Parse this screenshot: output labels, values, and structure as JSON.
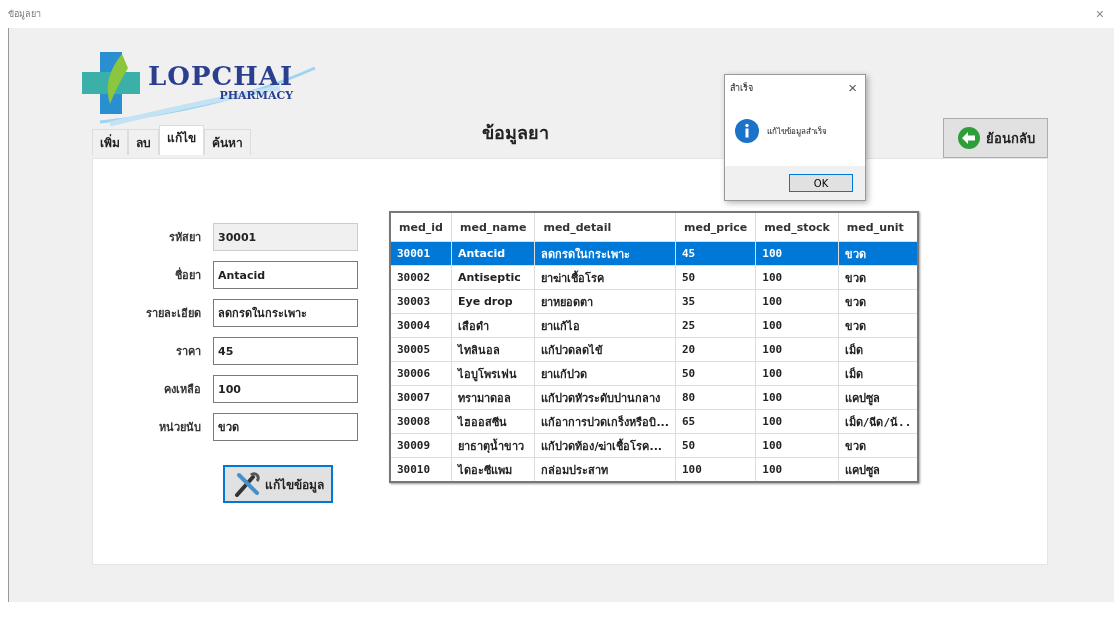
{
  "window": {
    "title": "ข้อมูลยา",
    "close": "×"
  },
  "logo": {
    "name": "LOPCHAI",
    "subtitle": "PHARMACY"
  },
  "tabs": [
    {
      "label": "เพิ่ม",
      "selected": false
    },
    {
      "label": "ลบ",
      "selected": false
    },
    {
      "label": "แก้ไข",
      "selected": true
    },
    {
      "label": "ค้นหา",
      "selected": false
    }
  ],
  "page_title": "ข้อมูลยา",
  "back_button": "ย้อนกลับ",
  "form": {
    "fields": [
      {
        "label": "รหัสยา",
        "value": "30001",
        "disabled": true
      },
      {
        "label": "ชื่อยา",
        "value": "Antacid",
        "disabled": false
      },
      {
        "label": "รายละเอียด",
        "value": "ลดกรดในกระเพาะ",
        "disabled": false
      },
      {
        "label": "ราคา",
        "value": "45",
        "disabled": false
      },
      {
        "label": "คงเหลือ",
        "value": "100",
        "disabled": false
      },
      {
        "label": "หน่วยนับ",
        "value": "ขวด",
        "disabled": false
      }
    ],
    "submit": "แก้ไขข้อมูล"
  },
  "table": {
    "columns": [
      "med_id",
      "med_name",
      "med_detail",
      "med_price",
      "med_stock",
      "med_unit"
    ],
    "rows": [
      {
        "cells": [
          "30001",
          "Antacid",
          "ลดกรดในกระเพาะ",
          "45",
          "100",
          "ขวด"
        ],
        "selected": true
      },
      {
        "cells": [
          "30002",
          "Antiseptic",
          "ยาฆ่าเชื้อโรค",
          "50",
          "100",
          "ขวด"
        ],
        "selected": false
      },
      {
        "cells": [
          "30003",
          "Eye drop",
          "ยาหยอดตา",
          "35",
          "100",
          "ขวด"
        ],
        "selected": false
      },
      {
        "cells": [
          "30004",
          "เสือดำ",
          "ยาแก้ไอ",
          "25",
          "100",
          "ขวด"
        ],
        "selected": false
      },
      {
        "cells": [
          "30005",
          "ไทลินอล",
          "แก้ปวดลดไข้",
          "20",
          "100",
          "เม็ด"
        ],
        "selected": false
      },
      {
        "cells": [
          "30006",
          "ไอบูโพรเฟน",
          "ยาแก้ปวด",
          "50",
          "100",
          "เม็ด"
        ],
        "selected": false
      },
      {
        "cells": [
          "30007",
          "ทรามาดอล",
          "แก้ปวดหัวระดับปานกลาง",
          "80",
          "100",
          "แคปซูล"
        ],
        "selected": false
      },
      {
        "cells": [
          "30008",
          "ไฮออสซีน",
          "แก้อาการปวดเกร็งหรือบิ...",
          "65",
          "100",
          "เม็ด/ฉีด/น้.."
        ],
        "selected": false
      },
      {
        "cells": [
          "30009",
          "ยาธาตุน้ำขาว",
          "แก้ปวดท้อง/ฆ่าเชื้อโรค...",
          "50",
          "100",
          "ขวด"
        ],
        "selected": false
      },
      {
        "cells": [
          "30010",
          "ไดอะซีแพม",
          "กล่อมประสาท",
          "100",
          "100",
          "แคปซูล"
        ],
        "selected": false
      }
    ]
  },
  "dialog": {
    "title": "สำเร็จ",
    "close": "×",
    "message": "แก้ไขข้อมูลสำเร็จ",
    "button": "OK"
  }
}
